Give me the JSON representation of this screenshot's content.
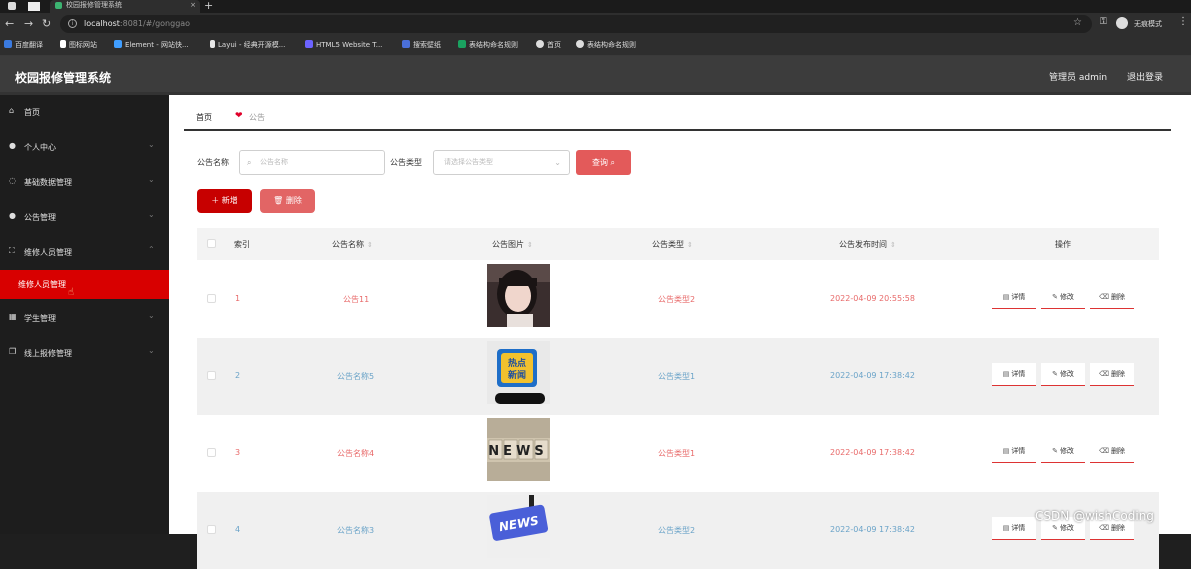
{
  "browser": {
    "tab_title": "校园报修管理系统",
    "url_host": "localhost",
    "url_path": ":8081/#/gonggao",
    "profile_label": "无痕模式",
    "bookmarks": [
      "百度翻译",
      "图标网站",
      "Element - 网站快...",
      "Layui - 经典开源模...",
      "HTML5 Website T...",
      "搜索壁纸",
      "表结构命名规则",
      "首页",
      "表结构命名规则"
    ]
  },
  "header": {
    "app_title": "校园报修管理系统",
    "user_label": "管理员 admin",
    "logout_label": "退出登录"
  },
  "sidebar": {
    "items": [
      {
        "label": "首页",
        "icon": "home-icon"
      },
      {
        "label": "个人中心",
        "icon": "user-icon"
      },
      {
        "label": "基础数据管理",
        "icon": "settings-icon"
      },
      {
        "label": "公告管理",
        "icon": "user-icon"
      },
      {
        "label": "维修人员管理",
        "icon": "frame-icon"
      },
      {
        "label": "学生管理",
        "icon": "chart-icon"
      },
      {
        "label": "线上报修管理",
        "icon": "copy-icon"
      }
    ],
    "active_sub_item": "维修人员管理"
  },
  "breadcrumb": {
    "home": "首页",
    "current": "公告"
  },
  "search": {
    "name_label": "公告名称",
    "name_placeholder": "公告名称",
    "type_label": "公告类型",
    "type_placeholder": "请选择公告类型",
    "query_label": "查询"
  },
  "actions": {
    "add_label": "新增",
    "delete_label": "删除"
  },
  "table": {
    "columns": [
      "索引",
      "公告名称",
      "公告图片",
      "公告类型",
      "公告发布时间",
      "操作"
    ],
    "row_actions": [
      "详情",
      "修改",
      "删除"
    ],
    "rows": [
      {
        "index": "1",
        "name": "公告11",
        "type": "公告类型2",
        "time": "2022-04-09 20:55:58"
      },
      {
        "index": "2",
        "name": "公告名称5",
        "type": "公告类型1",
        "time": "2022-04-09 17:38:42",
        "image_text": "热点新闻"
      },
      {
        "index": "3",
        "name": "公告名称4",
        "type": "公告类型1",
        "time": "2022-04-09 17:38:42",
        "image_text": "NEWS"
      },
      {
        "index": "4",
        "name": "公告名称3",
        "type": "公告类型2",
        "time": "2022-04-09 17:38:42",
        "image_text": "NEWS"
      }
    ]
  },
  "watermark": "CSDN @wishCoding"
}
